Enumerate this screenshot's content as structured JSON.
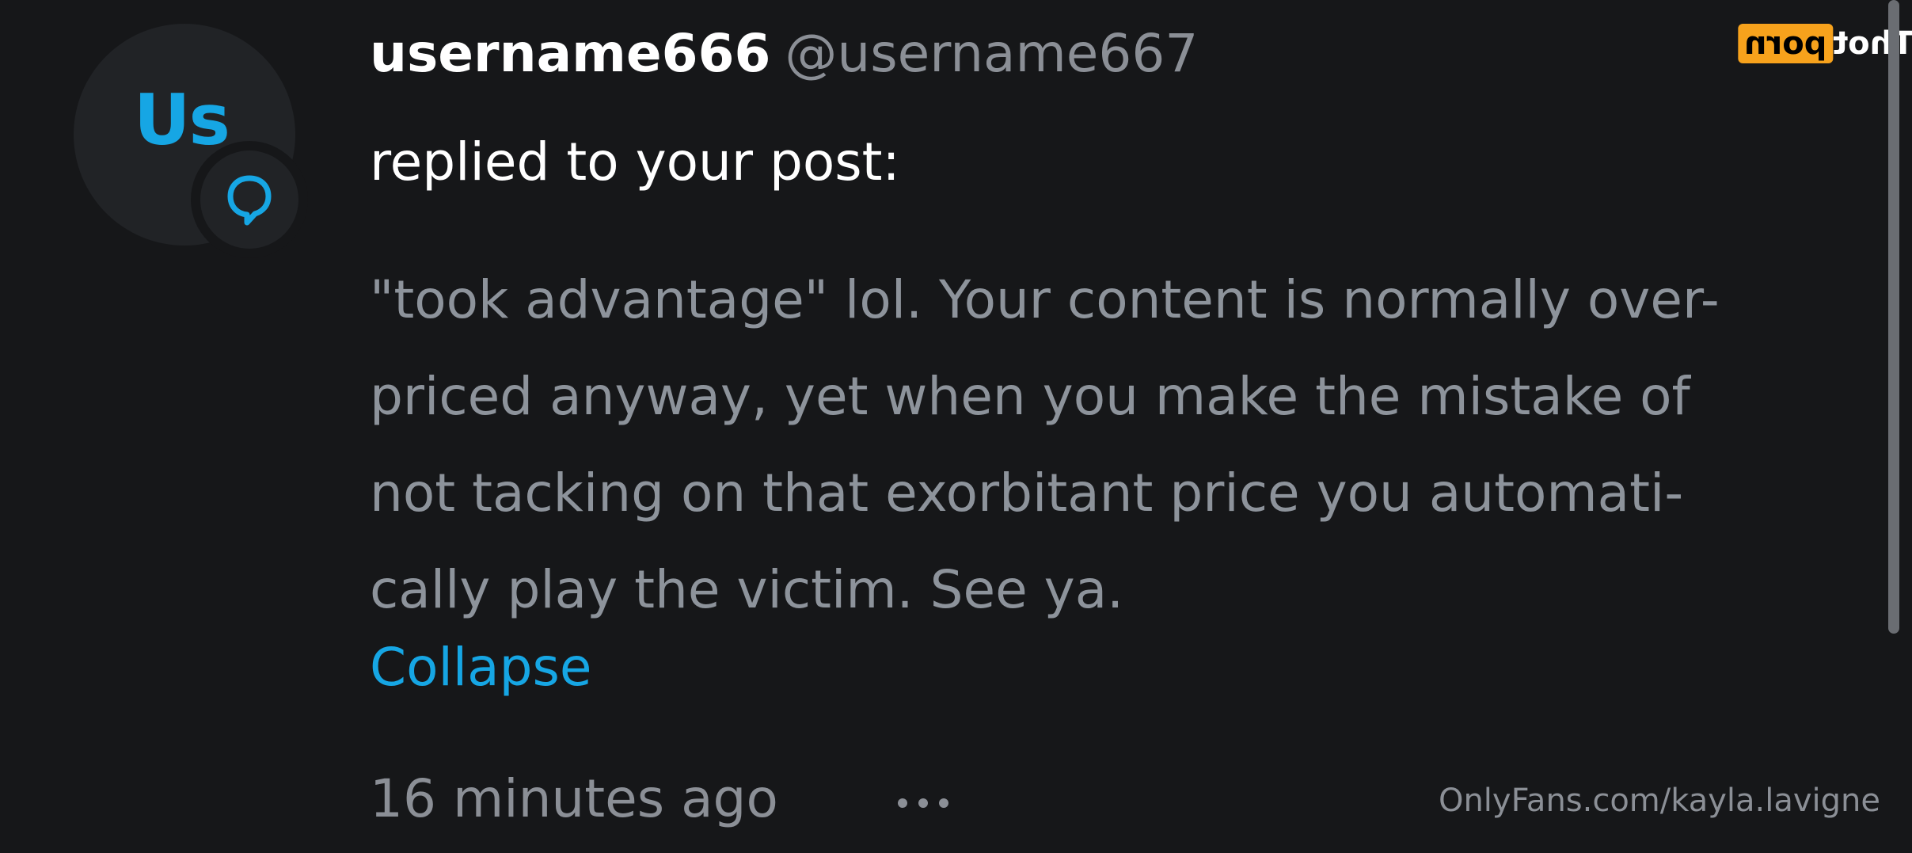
{
  "notification": {
    "avatar": {
      "initials": "Us",
      "badge_icon": "speech-bubble-icon"
    },
    "display_name": "username666",
    "handle": "@username667",
    "action": "replied to your post:",
    "comment_lines": [
      "\"took advantage\" lol. Your content is normally over-",
      "priced anyway, yet when you make the mistake of",
      "not tacking on that exorbitant price you automati-",
      "cally play the victim. See ya."
    ],
    "collapse_label": "Collapse",
    "timestamp": "16 minutes ago",
    "more_icon": "more-dots-icon"
  },
  "watermark": {
    "url": "OnlyFans.com/kayla.lavigne",
    "brand_part1": "porn",
    "brand_part2": "Thot"
  },
  "colors": {
    "background": "#161719",
    "accent": "#16a6e4",
    "primary_text": "#ffffff",
    "secondary_text": "#8b8f96",
    "body_text": "#8d939b",
    "logo_accent": "#f7a21c"
  }
}
